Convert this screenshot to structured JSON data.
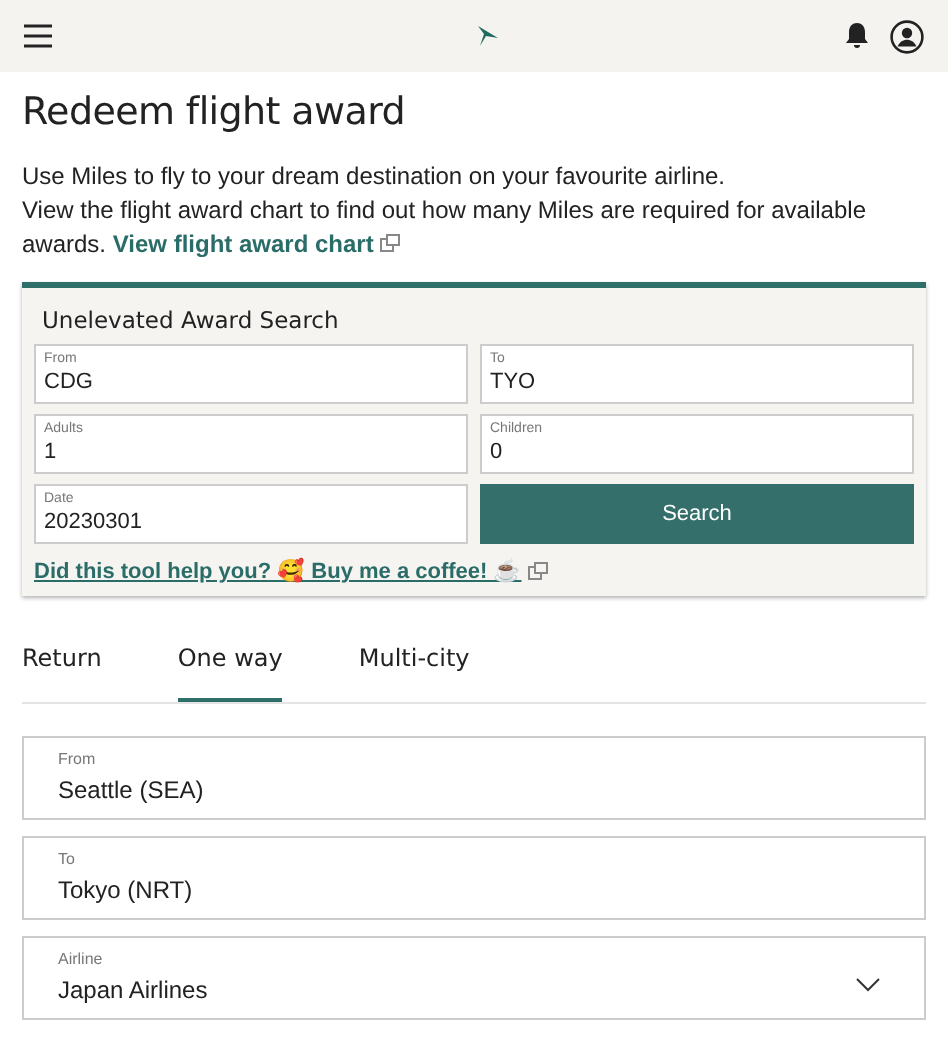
{
  "title": "Redeem flight award",
  "intro": {
    "line1": "Use Miles to fly to your dream destination on your favourite airline.",
    "line2": "View the flight award chart to find out how many Miles are required for available awards.",
    "link": "View flight award chart"
  },
  "search_card": {
    "title": "Unelevated Award Search",
    "fields": [
      {
        "label": "From",
        "value": "CDG"
      },
      {
        "label": "To",
        "value": "TYO"
      },
      {
        "label": "Adults",
        "value": "1"
      },
      {
        "label": "Children",
        "value": "0"
      },
      {
        "label": "Date",
        "value": "20230301"
      }
    ],
    "button": "Search",
    "coffee_link": "Did this tool help you? 🥰 Buy me a coffee! ☕"
  },
  "tabs": [
    {
      "label": "Return",
      "selected": false
    },
    {
      "label": "One way",
      "selected": true
    },
    {
      "label": "Multi-city",
      "selected": false
    }
  ],
  "form_fields": [
    {
      "kind": "text",
      "label": "From",
      "value": "Seattle (SEA)"
    },
    {
      "kind": "text",
      "label": "To",
      "value": "Tokyo (NRT)"
    },
    {
      "kind": "select",
      "label": "Airline",
      "value": "Japan Airlines"
    }
  ]
}
